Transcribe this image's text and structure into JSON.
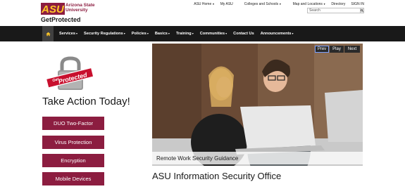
{
  "colors": {
    "brand_maroon": "#8c1d40",
    "nav_bg": "#191919",
    "home_active": "#404040"
  },
  "header": {
    "logo_line1": "Arizona State",
    "logo_line2": "University",
    "logo_letters": "ASU",
    "site_title": "GetProtected",
    "utility_links": [
      {
        "label": "ASU Home",
        "has_caret": true
      },
      {
        "label": "My ASU",
        "has_caret": false
      },
      {
        "label": "Colleges and Schools",
        "has_caret": true
      },
      {
        "label": "Map and Locations",
        "has_caret": true
      },
      {
        "label": "Directory",
        "has_caret": false
      },
      {
        "label": "SIGN IN",
        "has_caret": false
      }
    ],
    "search_placeholder": "Search",
    "search_icon": "search-icon"
  },
  "nav": {
    "home_icon": "home-icon",
    "items": [
      {
        "label": "Services",
        "caret": "▾"
      },
      {
        "label": "Security Regulations",
        "caret": "▾"
      },
      {
        "label": "Policies",
        "caret": "▾"
      },
      {
        "label": "Basics",
        "caret": "▾"
      },
      {
        "label": "Training",
        "caret": "▾"
      },
      {
        "label": "Communities",
        "caret": "▾"
      },
      {
        "label": "Contact Us",
        "caret": ""
      },
      {
        "label": "Announcements",
        "caret": "▾"
      }
    ]
  },
  "sidebar": {
    "badge_line1": "Get",
    "badge_line2": "Protected",
    "action_title": "Take Action Today!",
    "buttons": [
      "DUO Two-Factor",
      "Virus Protection",
      "Encryption",
      "Mobile Devices"
    ]
  },
  "hero": {
    "controls": {
      "prev": "Prev",
      "play": "Play",
      "next": "Next"
    },
    "caption": "Remote Work Security Guidance"
  },
  "main": {
    "title": "ASU Information Security Office"
  }
}
